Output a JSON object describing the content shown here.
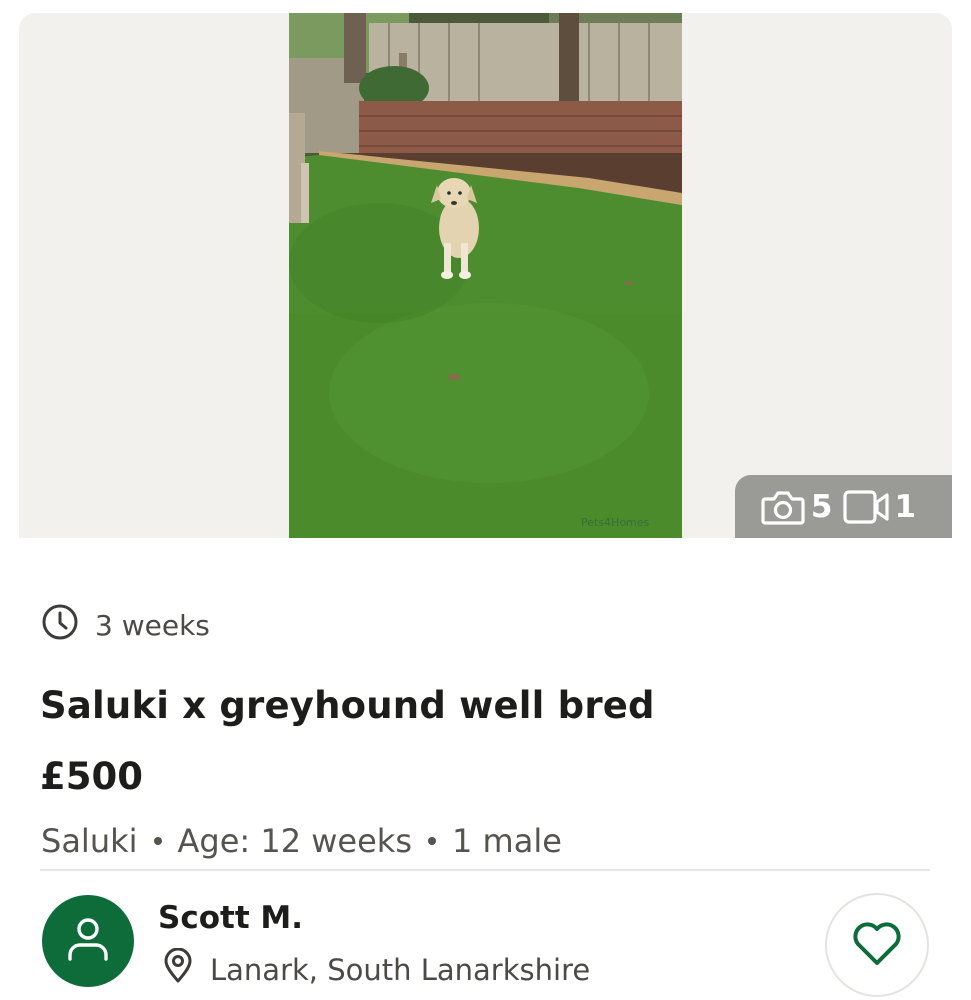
{
  "gallery": {
    "photo_count": "5",
    "video_count": "1",
    "watermark_alt": "Pets4Homes"
  },
  "listing": {
    "posted_ago": "3 weeks",
    "title": "Saluki x greyhound well bred",
    "price": "£500",
    "breed": "Saluki",
    "age": "Age: 12 weeks",
    "litter": "1 male"
  },
  "seller": {
    "name": "Scott M.",
    "location": "Lanark, South Lanarkshire"
  },
  "icons": {
    "clock": "clock-icon",
    "camera": "camera-icon",
    "video": "video-icon",
    "user": "user-icon",
    "pin": "location-pin-icon",
    "heart": "heart-icon"
  },
  "colors": {
    "brand_green": "#0e6b3a",
    "counter_bg": "#9a9a97",
    "media_bg": "#f2f1ed"
  }
}
